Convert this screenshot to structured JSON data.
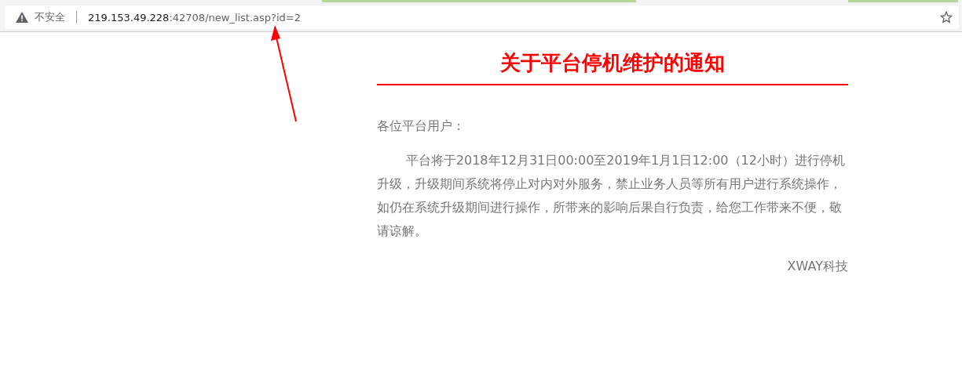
{
  "address_bar": {
    "security_label": "不安全",
    "url_host": "219.153.49.228",
    "url_rest": ":42708/new_list.asp?id=2"
  },
  "notice": {
    "title": "关于平台停机维护的通知",
    "greeting": "各位平台用户：",
    "body": "平台将于2018年12月31日00:00至2019年1月1日12:00（12小时）进行停机升级，升级期间系统将停止对内对外服务，禁止业务人员等所有用户进行系统操作，如仍在系统升级期间进行操作，所带来的影响后果自行负责，给您工作带来不便，敬请谅解。",
    "signature": "XWAY科技"
  }
}
